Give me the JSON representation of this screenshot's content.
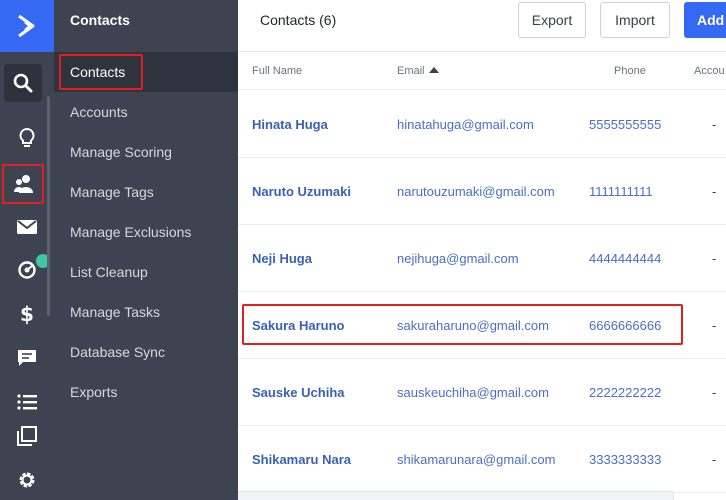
{
  "rail": {
    "icons": [
      "logo-icon",
      "search-icon",
      "lightbulb-icon",
      "contacts-icon",
      "mail-icon",
      "gauge-icon",
      "dollar-icon",
      "chat-icon",
      "list-icon",
      "copy-icon",
      "gear-icon"
    ]
  },
  "sidebar": {
    "title": "Contacts",
    "items": [
      {
        "label": "Contacts"
      },
      {
        "label": "Accounts"
      },
      {
        "label": "Manage Scoring"
      },
      {
        "label": "Manage Tags"
      },
      {
        "label": "Manage Exclusions"
      },
      {
        "label": "List Cleanup"
      },
      {
        "label": "Manage Tasks"
      },
      {
        "label": "Database Sync"
      },
      {
        "label": "Exports"
      }
    ]
  },
  "header": {
    "title": "Contacts (6)",
    "export_label": "Export",
    "import_label": "Import",
    "add_label": "Add"
  },
  "table": {
    "columns": [
      "Full Name",
      "Email",
      "Phone",
      "Accou"
    ],
    "rows": [
      {
        "name": "Hinata Huga",
        "email": "hinatahuga@gmail.com",
        "phone": "5555555555",
        "account": "-"
      },
      {
        "name": "Naruto Uzumaki",
        "email": "narutouzumaki@gmail.com",
        "phone": "1111111111",
        "account": "-"
      },
      {
        "name": "Neji Huga",
        "email": "nejihuga@gmail.com",
        "phone": "4444444444",
        "account": "-"
      },
      {
        "name": "Sakura Haruno",
        "email": "sakuraharuno@gmail.com",
        "phone": "6666666666",
        "account": "-"
      },
      {
        "name": "Sauske Uchiha",
        "email": "sauskeuchiha@gmail.com",
        "phone": "2222222222",
        "account": "-"
      },
      {
        "name": "Shikamaru Nara",
        "email": "shikamarunara@gmail.com",
        "phone": "3333333333",
        "account": "-"
      }
    ]
  },
  "colors": {
    "accent": "#3569f3",
    "sidebar": "#3d4350",
    "highlight": "#e02020",
    "status_dot": "#3ec6a6"
  }
}
